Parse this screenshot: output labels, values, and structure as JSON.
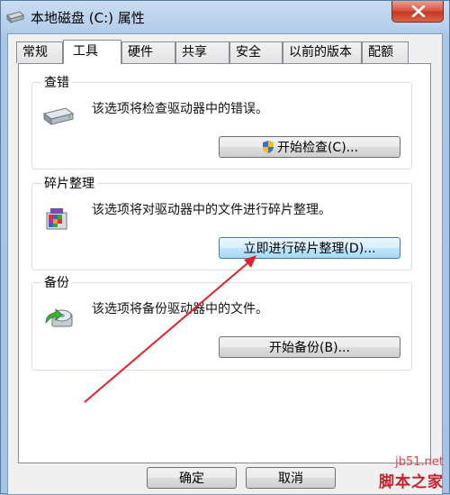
{
  "window": {
    "title": "本地磁盘 (C:) 属性"
  },
  "tabs": [
    {
      "label": "常规"
    },
    {
      "label": "工具",
      "active": true
    },
    {
      "label": "硬件"
    },
    {
      "label": "共享"
    },
    {
      "label": "安全"
    },
    {
      "label": "以前的版本"
    },
    {
      "label": "配额"
    }
  ],
  "error_check": {
    "title": "查错",
    "desc": "该选项将检查驱动器中的错误。",
    "button": "开始检查(C)..."
  },
  "defrag": {
    "title": "碎片整理",
    "desc": "该选项将对驱动器中的文件进行碎片整理。",
    "button": "立即进行碎片整理(D)..."
  },
  "backup": {
    "title": "备份",
    "desc": "该选项将备份驱动器中的文件。",
    "button": "开始备份(B)..."
  },
  "footer": {
    "ok": "确定",
    "cancel": "取消"
  },
  "watermark": {
    "url": "jb51.net",
    "name": "脚本之家"
  },
  "colors": {
    "annotation_arrow": "#e0232b",
    "hover_button": "#bee6fd"
  }
}
